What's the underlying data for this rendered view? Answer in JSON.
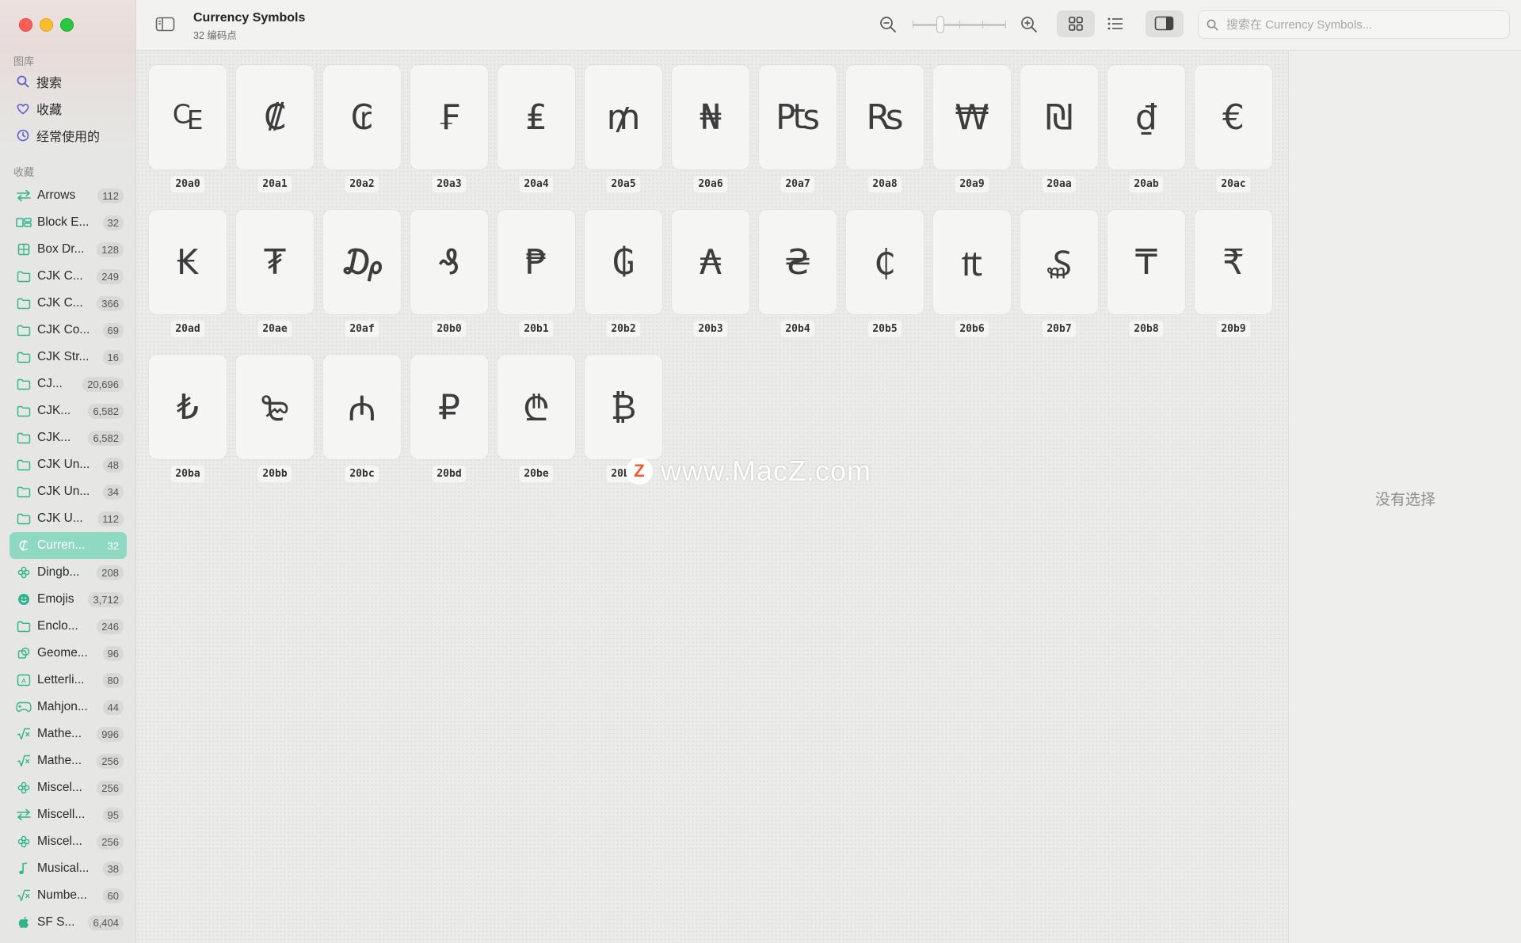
{
  "sidebar": {
    "library_label": "图库",
    "library_items": [
      {
        "label": "搜索",
        "icon": "search-icon"
      },
      {
        "label": "收藏",
        "icon": "heart-icon"
      },
      {
        "label": "经常使用的",
        "icon": "clock-icon"
      }
    ],
    "collections_label": "收藏",
    "collections": [
      {
        "label": "Arrows",
        "count": "112",
        "icon": "arrows-icon"
      },
      {
        "label": "Block E...",
        "count": "32",
        "icon": "block-elements-icon"
      },
      {
        "label": "Box Dr...",
        "count": "128",
        "icon": "box-drawing-icon"
      },
      {
        "label": "CJK C...",
        "count": "249",
        "icon": "folder-icon"
      },
      {
        "label": "CJK C...",
        "count": "366",
        "icon": "folder-icon"
      },
      {
        "label": "CJK Co...",
        "count": "69",
        "icon": "folder-icon"
      },
      {
        "label": "CJK Str...",
        "count": "16",
        "icon": "folder-icon"
      },
      {
        "label": "CJ...",
        "count": "20,696",
        "icon": "folder-icon"
      },
      {
        "label": "CJK...",
        "count": "6,582",
        "icon": "folder-icon"
      },
      {
        "label": "CJK...",
        "count": "6,582",
        "icon": "folder-icon"
      },
      {
        "label": "CJK Un...",
        "count": "48",
        "icon": "folder-icon"
      },
      {
        "label": "CJK Un...",
        "count": "34",
        "icon": "folder-icon"
      },
      {
        "label": "CJK U...",
        "count": "112",
        "icon": "folder-icon"
      },
      {
        "label": "Curren...",
        "count": "32",
        "icon": "currency-icon",
        "active": true
      },
      {
        "label": "Dingb...",
        "count": "208",
        "icon": "dingbats-icon"
      },
      {
        "label": "Emojis",
        "count": "3,712",
        "icon": "emoji-icon"
      },
      {
        "label": "Enclo...",
        "count": "246",
        "icon": "folder-icon"
      },
      {
        "label": "Geome...",
        "count": "96",
        "icon": "geometric-icon"
      },
      {
        "label": "Letterli...",
        "count": "80",
        "icon": "letterlike-icon"
      },
      {
        "label": "Mahjon...",
        "count": "44",
        "icon": "gamepad-icon"
      },
      {
        "label": "Mathe...",
        "count": "996",
        "icon": "sqrt-icon"
      },
      {
        "label": "Mathe...",
        "count": "256",
        "icon": "sqrt-icon"
      },
      {
        "label": "Miscel...",
        "count": "256",
        "icon": "dingbats-icon"
      },
      {
        "label": "Miscell...",
        "count": "95",
        "icon": "arrows-icon"
      },
      {
        "label": "Miscel...",
        "count": "256",
        "icon": "dingbats-icon"
      },
      {
        "label": "Musical...",
        "count": "38",
        "icon": "music-note-icon"
      },
      {
        "label": "Numbe...",
        "count": "60",
        "icon": "sqrt-icon"
      },
      {
        "label": "SF S...",
        "count": "6,404",
        "icon": "apple-icon"
      }
    ]
  },
  "toolbar": {
    "title": "Currency Symbols",
    "subtitle": "32 编码点",
    "search_placeholder": "搜索在 Currency Symbols..."
  },
  "glyphs": [
    {
      "char": "₠",
      "code": "20a0"
    },
    {
      "char": "₡",
      "code": "20a1"
    },
    {
      "char": "₢",
      "code": "20a2"
    },
    {
      "char": "₣",
      "code": "20a3"
    },
    {
      "char": "₤",
      "code": "20a4"
    },
    {
      "char": "₥",
      "code": "20a5"
    },
    {
      "char": "₦",
      "code": "20a6"
    },
    {
      "char": "₧",
      "code": "20a7"
    },
    {
      "char": "₨",
      "code": "20a8"
    },
    {
      "char": "₩",
      "code": "20a9"
    },
    {
      "char": "₪",
      "code": "20aa"
    },
    {
      "char": "₫",
      "code": "20ab"
    },
    {
      "char": "€",
      "code": "20ac"
    },
    {
      "char": "₭",
      "code": "20ad"
    },
    {
      "char": "₮",
      "code": "20ae"
    },
    {
      "char": "₯",
      "code": "20af"
    },
    {
      "char": "₰",
      "code": "20b0"
    },
    {
      "char": "₱",
      "code": "20b1"
    },
    {
      "char": "₲",
      "code": "20b2"
    },
    {
      "char": "₳",
      "code": "20b3"
    },
    {
      "char": "₴",
      "code": "20b4"
    },
    {
      "char": "₵",
      "code": "20b5"
    },
    {
      "char": "₶",
      "code": "20b6"
    },
    {
      "char": "₷",
      "code": "20b7"
    },
    {
      "char": "₸",
      "code": "20b8"
    },
    {
      "char": "₹",
      "code": "20b9"
    },
    {
      "char": "₺",
      "code": "20ba"
    },
    {
      "char": "₻",
      "code": "20bb"
    },
    {
      "char": "₼",
      "code": "20bc"
    },
    {
      "char": "₽",
      "code": "20bd"
    },
    {
      "char": "₾",
      "code": "20be"
    },
    {
      "char": "₿",
      "code": "20bf"
    }
  ],
  "inspector": {
    "empty_text": "没有选择"
  },
  "watermark": {
    "logo_letter": "Z",
    "text": "www.MacZ.com"
  },
  "colors": {
    "accent": "#8fd9c3",
    "icon_teal": "#2fb38b",
    "icon_purple": "#5b5fd0"
  }
}
